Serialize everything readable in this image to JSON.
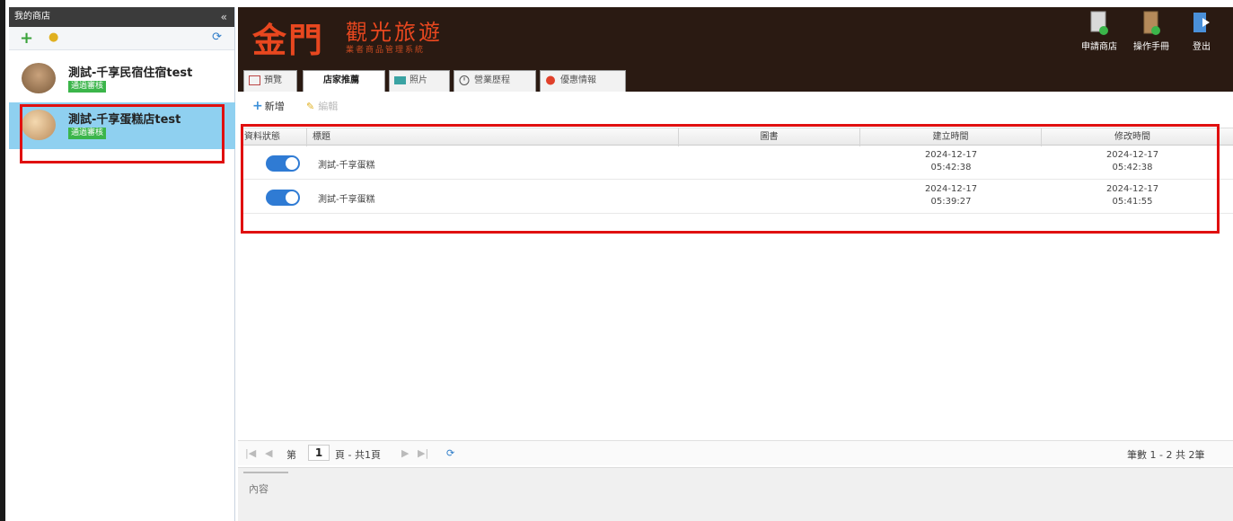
{
  "sidebar": {
    "title": "我的商店",
    "collapse_glyph": "«",
    "shops": [
      {
        "name": "測試-千享民宿住宿test",
        "status": "通過審核"
      },
      {
        "name": "測試-千享蛋糕店test",
        "status": "通過審核"
      }
    ]
  },
  "header": {
    "logo_main": "金門",
    "logo_sub": "觀光旅遊",
    "logo_tagline": "業者商品管理系統",
    "buttons": [
      {
        "label": "申請商店"
      },
      {
        "label": "操作手冊"
      },
      {
        "label": "登出"
      }
    ]
  },
  "tabs": [
    {
      "label": "預覽"
    },
    {
      "label": "店家推薦"
    },
    {
      "label": "照片"
    },
    {
      "label": "營業歷程"
    },
    {
      "label": "優惠情報"
    }
  ],
  "toolbar": {
    "add_label": "新增",
    "edit_label": "編輯"
  },
  "grid": {
    "columns": [
      "資料狀態",
      "標題",
      "圖書",
      "建立時間",
      "修改時間"
    ],
    "rows": [
      {
        "title": "測試-千享蛋糕",
        "created_date": "2024-12-17",
        "created_time": "05:42:38",
        "modified_date": "2024-12-17",
        "modified_time": "05:42:38",
        "enabled": true
      },
      {
        "title": "測試-千享蛋糕",
        "created_date": "2024-12-17",
        "created_time": "05:39:27",
        "modified_date": "2024-12-17",
        "modified_time": "05:41:55",
        "enabled": true
      }
    ]
  },
  "pager": {
    "prefix": "第",
    "page": "1",
    "suffix": "頁 - 共1頁",
    "summary": "筆數 1 - 2 共 2筆"
  },
  "content_panel": {
    "label": "內容"
  },
  "colors": {
    "header_bg": "#2a1a12",
    "logo": "#e8471f",
    "highlight": "#e01010",
    "toggle": "#2f7bd4",
    "badge": "#3bb54a",
    "selected_shop": "#8fd0f0"
  }
}
